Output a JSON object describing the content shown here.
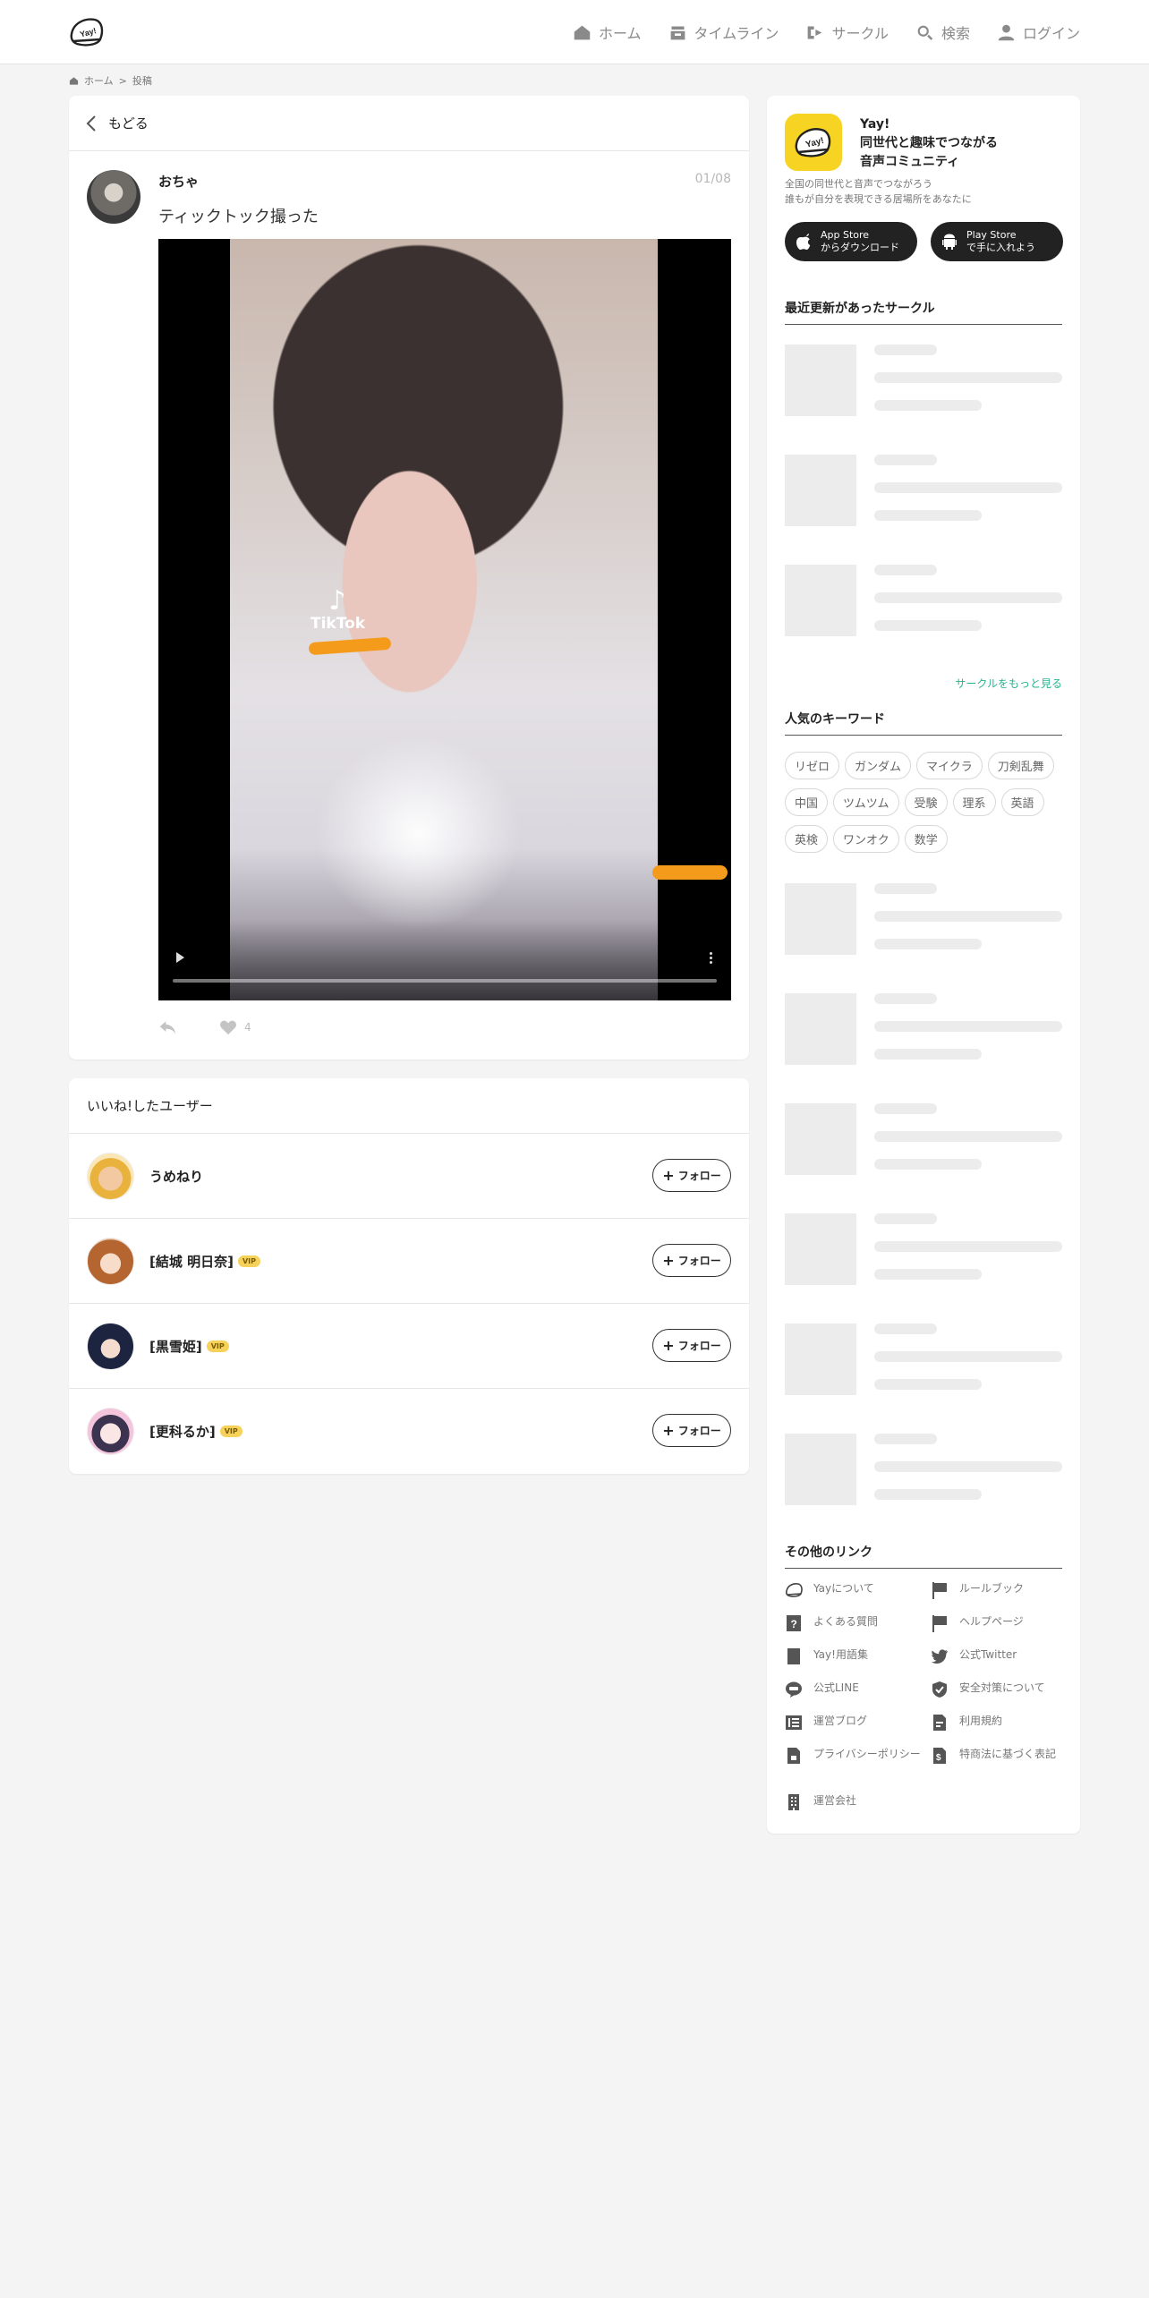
{
  "header": {
    "nav": [
      {
        "label": "ホーム",
        "icon": "home-icon"
      },
      {
        "label": "タイムライン",
        "icon": "timeline-icon"
      },
      {
        "label": "サークル",
        "icon": "circle-icon"
      },
      {
        "label": "検索",
        "icon": "search-icon"
      },
      {
        "label": "ログイン",
        "icon": "user-icon"
      }
    ]
  },
  "breadcrumb": {
    "home": "ホーム",
    "separator": ">",
    "current": "投稿"
  },
  "post": {
    "back_label": "もどる",
    "username": "おちゃ",
    "date": "01/08",
    "text": "ティックトック撮った",
    "video_watermark": "TikTok",
    "like_count": "4"
  },
  "likes": {
    "title": "いいね!したユーザー",
    "follow_label": "フォロー",
    "vip_label": "VIP",
    "users": [
      {
        "name": "うめねり",
        "vip": false
      },
      {
        "name": "⁅結城 明日奈⁆",
        "vip": true
      },
      {
        "name": "⁅黒雪姫⁆",
        "vip": true
      },
      {
        "name": "⁅更科るか⁆",
        "vip": true
      }
    ]
  },
  "sidebar": {
    "app_name_lines": [
      "Yay!",
      "同世代と趣味でつながる",
      "音声コミュニティ"
    ],
    "app_desc_lines": [
      "全国の同世代と音声でつながろう",
      "誰もが自分を表現できる居場所をあなたに"
    ],
    "app_store": {
      "line1": "App Store",
      "line2": "からダウンロード"
    },
    "play_store": {
      "line1": "Play Store",
      "line2": "で手に入れよう"
    },
    "recent_circles_title": "最近更新があったサークル",
    "more_circles": "サークルをもっと見る",
    "keywords_title": "人気のキーワード",
    "keywords": [
      "リゼロ",
      "ガンダム",
      "マイクラ",
      "刀剣乱舞",
      "中国",
      "ツムツム",
      "受験",
      "理系",
      "英語",
      "英検",
      "ワンオク",
      "数学"
    ],
    "other_links_title": "その他のリンク",
    "links": [
      {
        "label": "Yayについて",
        "icon": "yay-logo-icon"
      },
      {
        "label": "ルールブック",
        "icon": "flag-icon"
      },
      {
        "label": "よくある質問",
        "icon": "question-icon"
      },
      {
        "label": "ヘルプページ",
        "icon": "flag-icon"
      },
      {
        "label": "Yay!用語集",
        "icon": "book-icon"
      },
      {
        "label": "公式Twitter",
        "icon": "twitter-icon"
      },
      {
        "label": "公式LINE",
        "icon": "line-icon"
      },
      {
        "label": "安全対策について",
        "icon": "shield-icon"
      },
      {
        "label": "運営ブログ",
        "icon": "blog-icon"
      },
      {
        "label": "利用規約",
        "icon": "document-icon"
      },
      {
        "label": "プライバシーポリシー",
        "icon": "lock-document-icon"
      },
      {
        "label": "特商法に基づく表記",
        "icon": "dollar-document-icon"
      },
      {
        "label": "運営会社",
        "icon": "building-icon"
      }
    ]
  },
  "colors": {
    "accent_green": "#27b48f",
    "brand_yellow": "#f7d323",
    "vip": "#f7d25b"
  }
}
